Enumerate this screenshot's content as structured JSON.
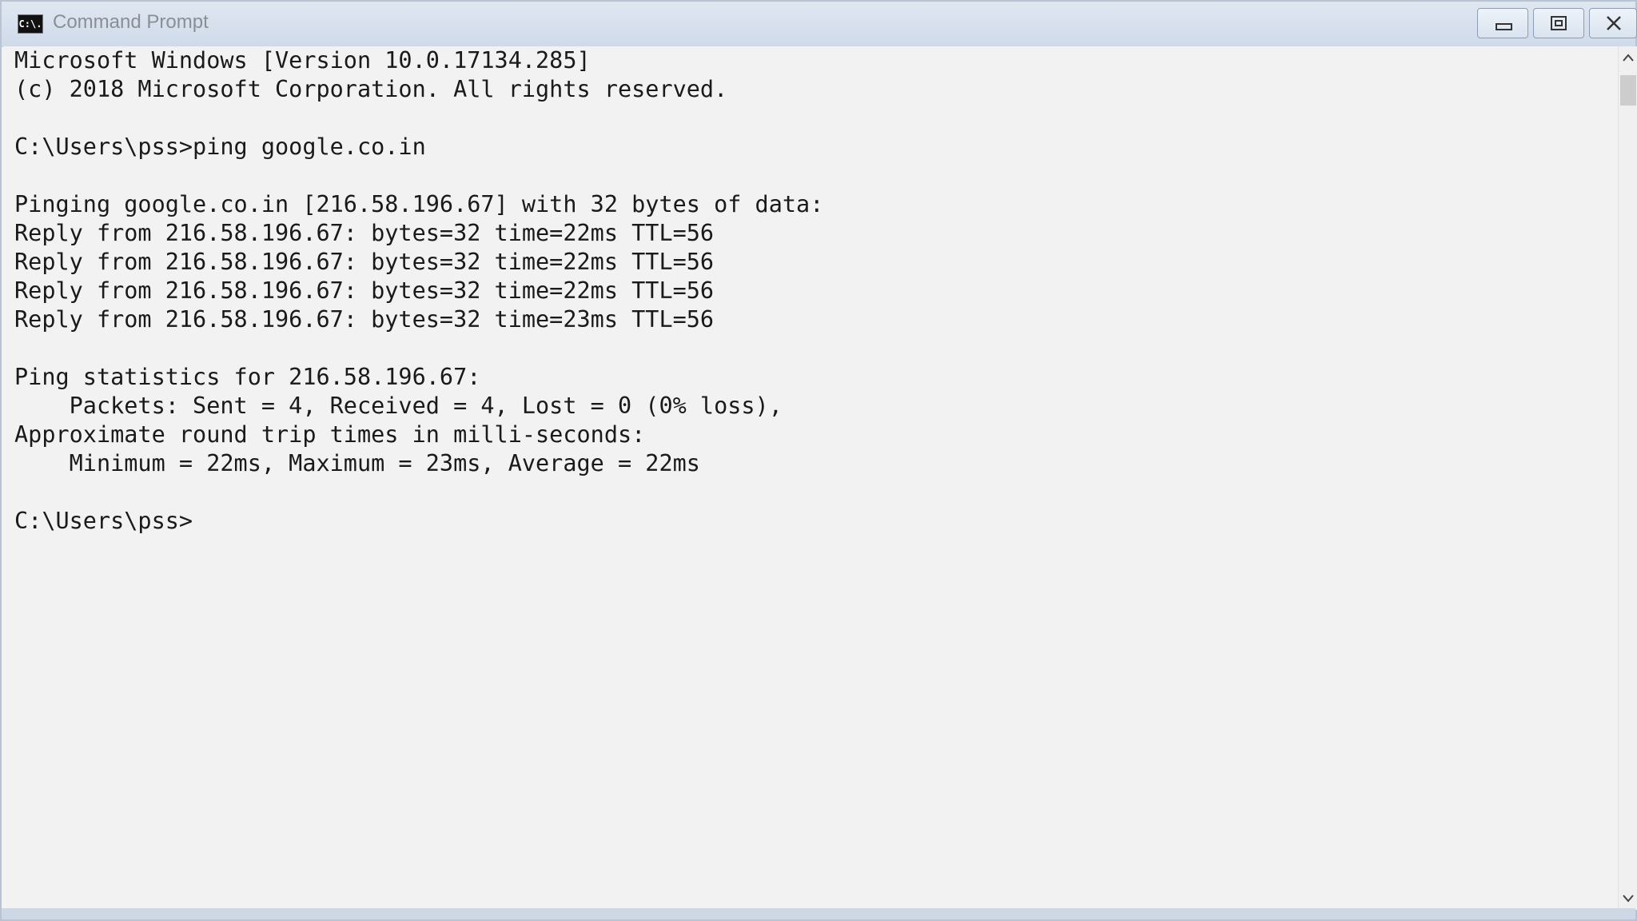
{
  "window": {
    "title": "Command Prompt",
    "icon_text": "C:\\."
  },
  "console": {
    "lines": [
      "Microsoft Windows [Version 10.0.17134.285]",
      "(c) 2018 Microsoft Corporation. All rights reserved.",
      "",
      "C:\\Users\\pss>ping google.co.in",
      "",
      "Pinging google.co.in [216.58.196.67] with 32 bytes of data:",
      "Reply from 216.58.196.67: bytes=32 time=22ms TTL=56",
      "Reply from 216.58.196.67: bytes=32 time=22ms TTL=56",
      "Reply from 216.58.196.67: bytes=32 time=22ms TTL=56",
      "Reply from 216.58.196.67: bytes=32 time=23ms TTL=56",
      "",
      "Ping statistics for 216.58.196.67:",
      "    Packets: Sent = 4, Received = 4, Lost = 0 (0% loss),",
      "Approximate round trip times in milli-seconds:",
      "    Minimum = 22ms, Maximum = 23ms, Average = 22ms",
      "",
      "C:\\Users\\pss>"
    ]
  },
  "icons": {
    "app": "cmd-icon",
    "minimize": "minimize-icon",
    "maximize": "restore-icon",
    "close": "close-icon",
    "scroll_up": "chevron-up-icon",
    "scroll_down": "chevron-down-icon"
  },
  "colors": {
    "console_background": "#f2f2f2",
    "console_text": "#1a1a1a",
    "titlebar": "#d6e0ed"
  }
}
